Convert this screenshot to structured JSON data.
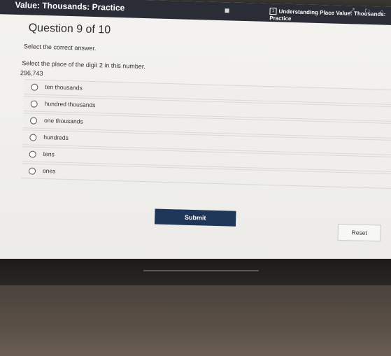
{
  "topbar": {
    "app_title": "Value: Thousands: Practice",
    "tab_badge": "1",
    "tab_title": "Understanding Place Value: Thousands: Practice",
    "browser_icons": "⤢ ↻ ⌂"
  },
  "question": {
    "title": "Question 9 of 10",
    "instruction": "Select the correct answer.",
    "prompt": "Select the place of the digit 2 in this number.",
    "number": "296,743"
  },
  "options": [
    {
      "label": "ten thousands"
    },
    {
      "label": "hundred thousands"
    },
    {
      "label": "one thousands"
    },
    {
      "label": "hundreds"
    },
    {
      "label": "tens"
    },
    {
      "label": "ones"
    }
  ],
  "buttons": {
    "submit_label": "Submit",
    "reset_label": "Reset"
  },
  "colors": {
    "submit_bg": "#1e3657",
    "topbar_bg": "#2a2d35"
  }
}
